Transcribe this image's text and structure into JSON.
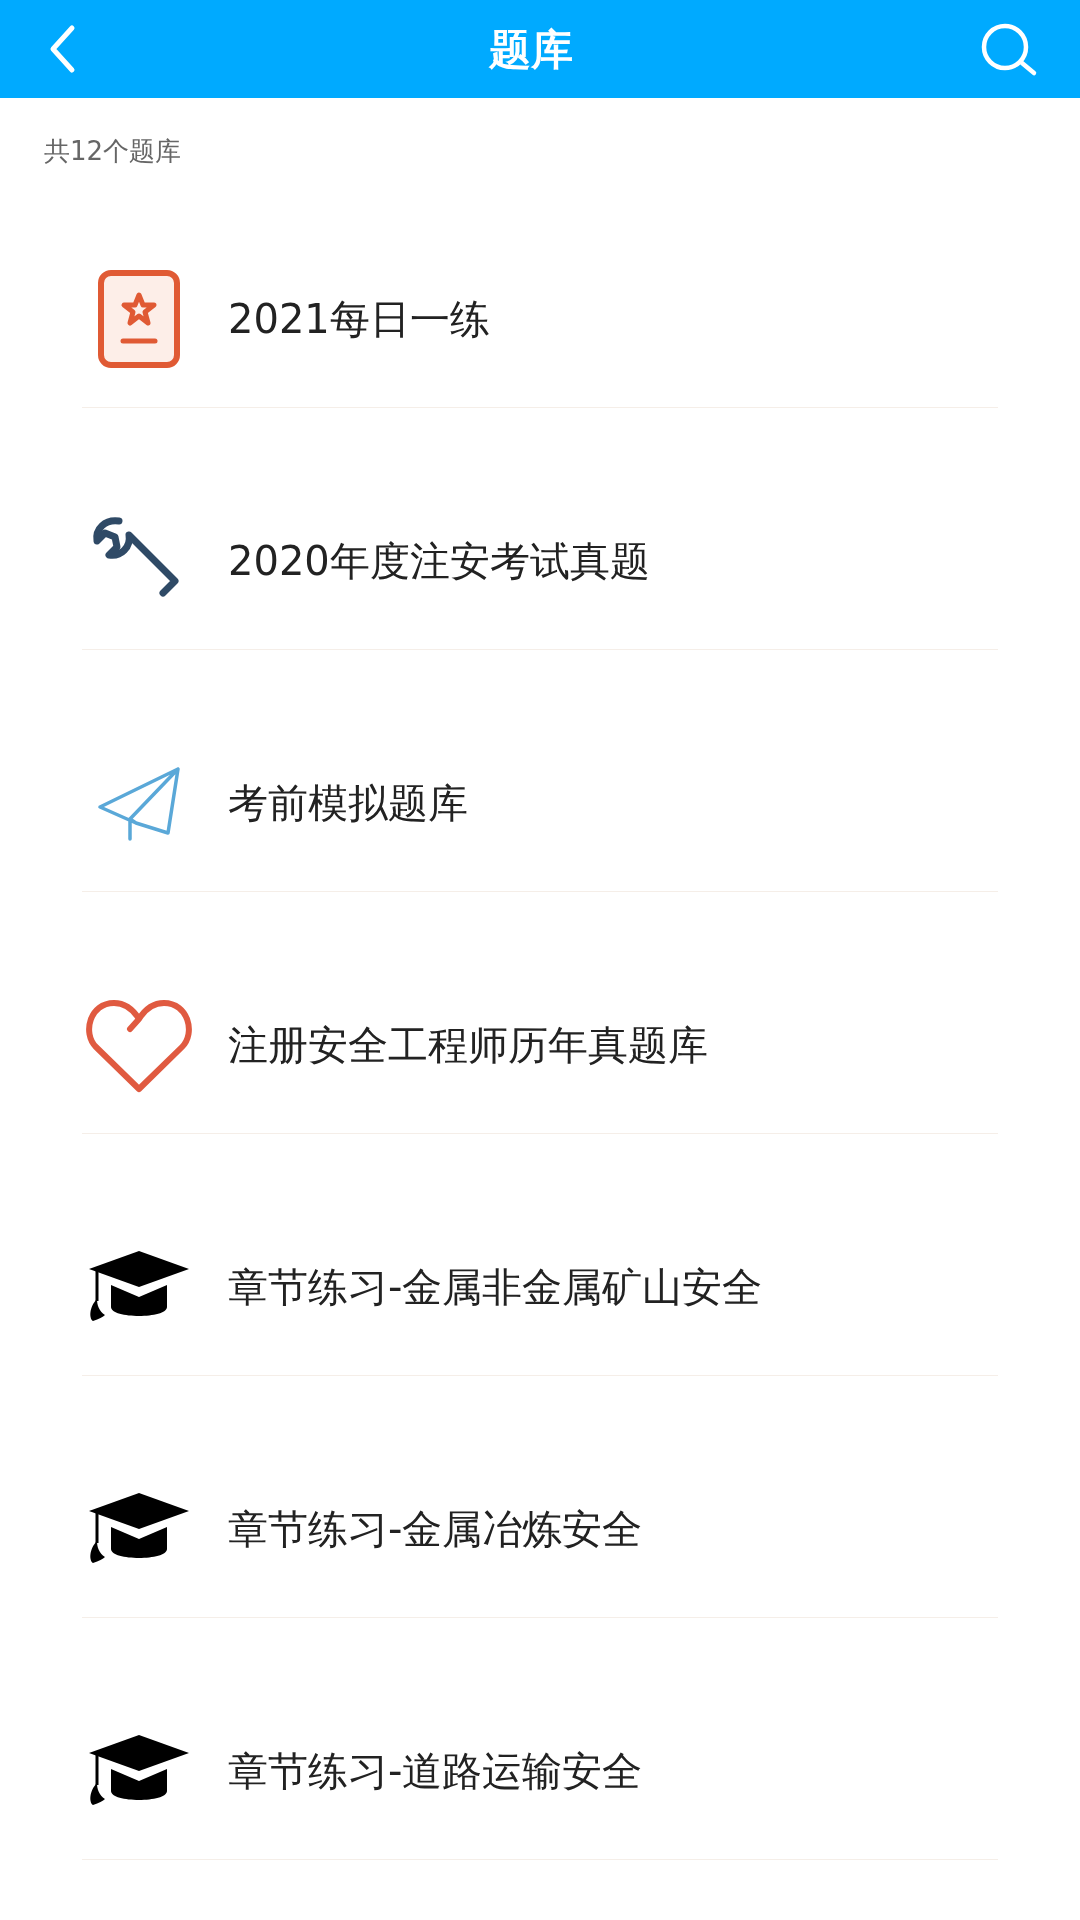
{
  "header": {
    "title": "题库"
  },
  "count": "共12个题库",
  "items": [
    {
      "kind": "card",
      "label": "2021每日一练"
    },
    {
      "kind": "wrench",
      "label": "2020年度注安考试真题"
    },
    {
      "kind": "plane",
      "label": "考前模拟题库"
    },
    {
      "kind": "heart",
      "label": "注册安全工程师历年真题库"
    },
    {
      "kind": "cap",
      "label": "章节练习-金属非金属矿山安全"
    },
    {
      "kind": "cap",
      "label": "章节练习-金属冶炼安全"
    },
    {
      "kind": "cap",
      "label": "章节练习-道路运输安全"
    }
  ]
}
